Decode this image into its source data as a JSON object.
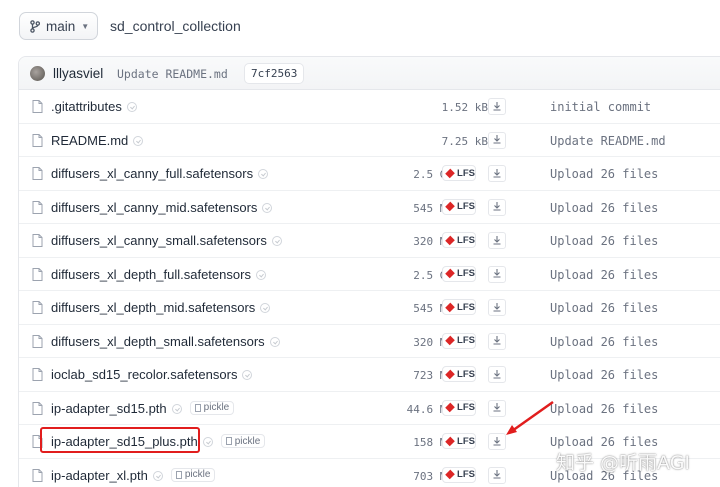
{
  "header": {
    "branch_label": "main",
    "repo_name": "sd_control_collection"
  },
  "latest_commit": {
    "author": "lllyasviel",
    "message": "Update README.md",
    "hash": "7cf2563"
  },
  "files": [
    {
      "name": ".gitattributes",
      "size": "1.52 kB",
      "lfs": false,
      "pickle": false,
      "commit": "initial commit"
    },
    {
      "name": "README.md",
      "size": "7.25 kB",
      "lfs": false,
      "pickle": false,
      "commit": "Update README.md"
    },
    {
      "name": "diffusers_xl_canny_full.safetensors",
      "size": "2.5 GB",
      "lfs": true,
      "pickle": false,
      "commit": "Upload 26 files"
    },
    {
      "name": "diffusers_xl_canny_mid.safetensors",
      "size": "545 MB",
      "lfs": true,
      "pickle": false,
      "commit": "Upload 26 files"
    },
    {
      "name": "diffusers_xl_canny_small.safetensors",
      "size": "320 MB",
      "lfs": true,
      "pickle": false,
      "commit": "Upload 26 files"
    },
    {
      "name": "diffusers_xl_depth_full.safetensors",
      "size": "2.5 GB",
      "lfs": true,
      "pickle": false,
      "commit": "Upload 26 files"
    },
    {
      "name": "diffusers_xl_depth_mid.safetensors",
      "size": "545 MB",
      "lfs": true,
      "pickle": false,
      "commit": "Upload 26 files"
    },
    {
      "name": "diffusers_xl_depth_small.safetensors",
      "size": "320 MB",
      "lfs": true,
      "pickle": false,
      "commit": "Upload 26 files"
    },
    {
      "name": "ioclab_sd15_recolor.safetensors",
      "size": "723 MB",
      "lfs": true,
      "pickle": false,
      "commit": "Upload 26 files"
    },
    {
      "name": "ip-adapter_sd15.pth",
      "size": "44.6 MB",
      "lfs": true,
      "pickle": true,
      "commit": "Upload 26 files"
    },
    {
      "name": "ip-adapter_sd15_plus.pth",
      "size": "158 MB",
      "lfs": true,
      "pickle": true,
      "commit": "Upload 26 files"
    },
    {
      "name": "ip-adapter_xl.pth",
      "size": "703 MB",
      "lfs": true,
      "pickle": true,
      "commit": "Upload 26 files"
    }
  ],
  "labels": {
    "lfs": "LFS",
    "pickle": "pickle"
  },
  "annotation": {
    "highlight_color": "#e11d1d"
  },
  "watermark": "知乎 @听雨AGI"
}
